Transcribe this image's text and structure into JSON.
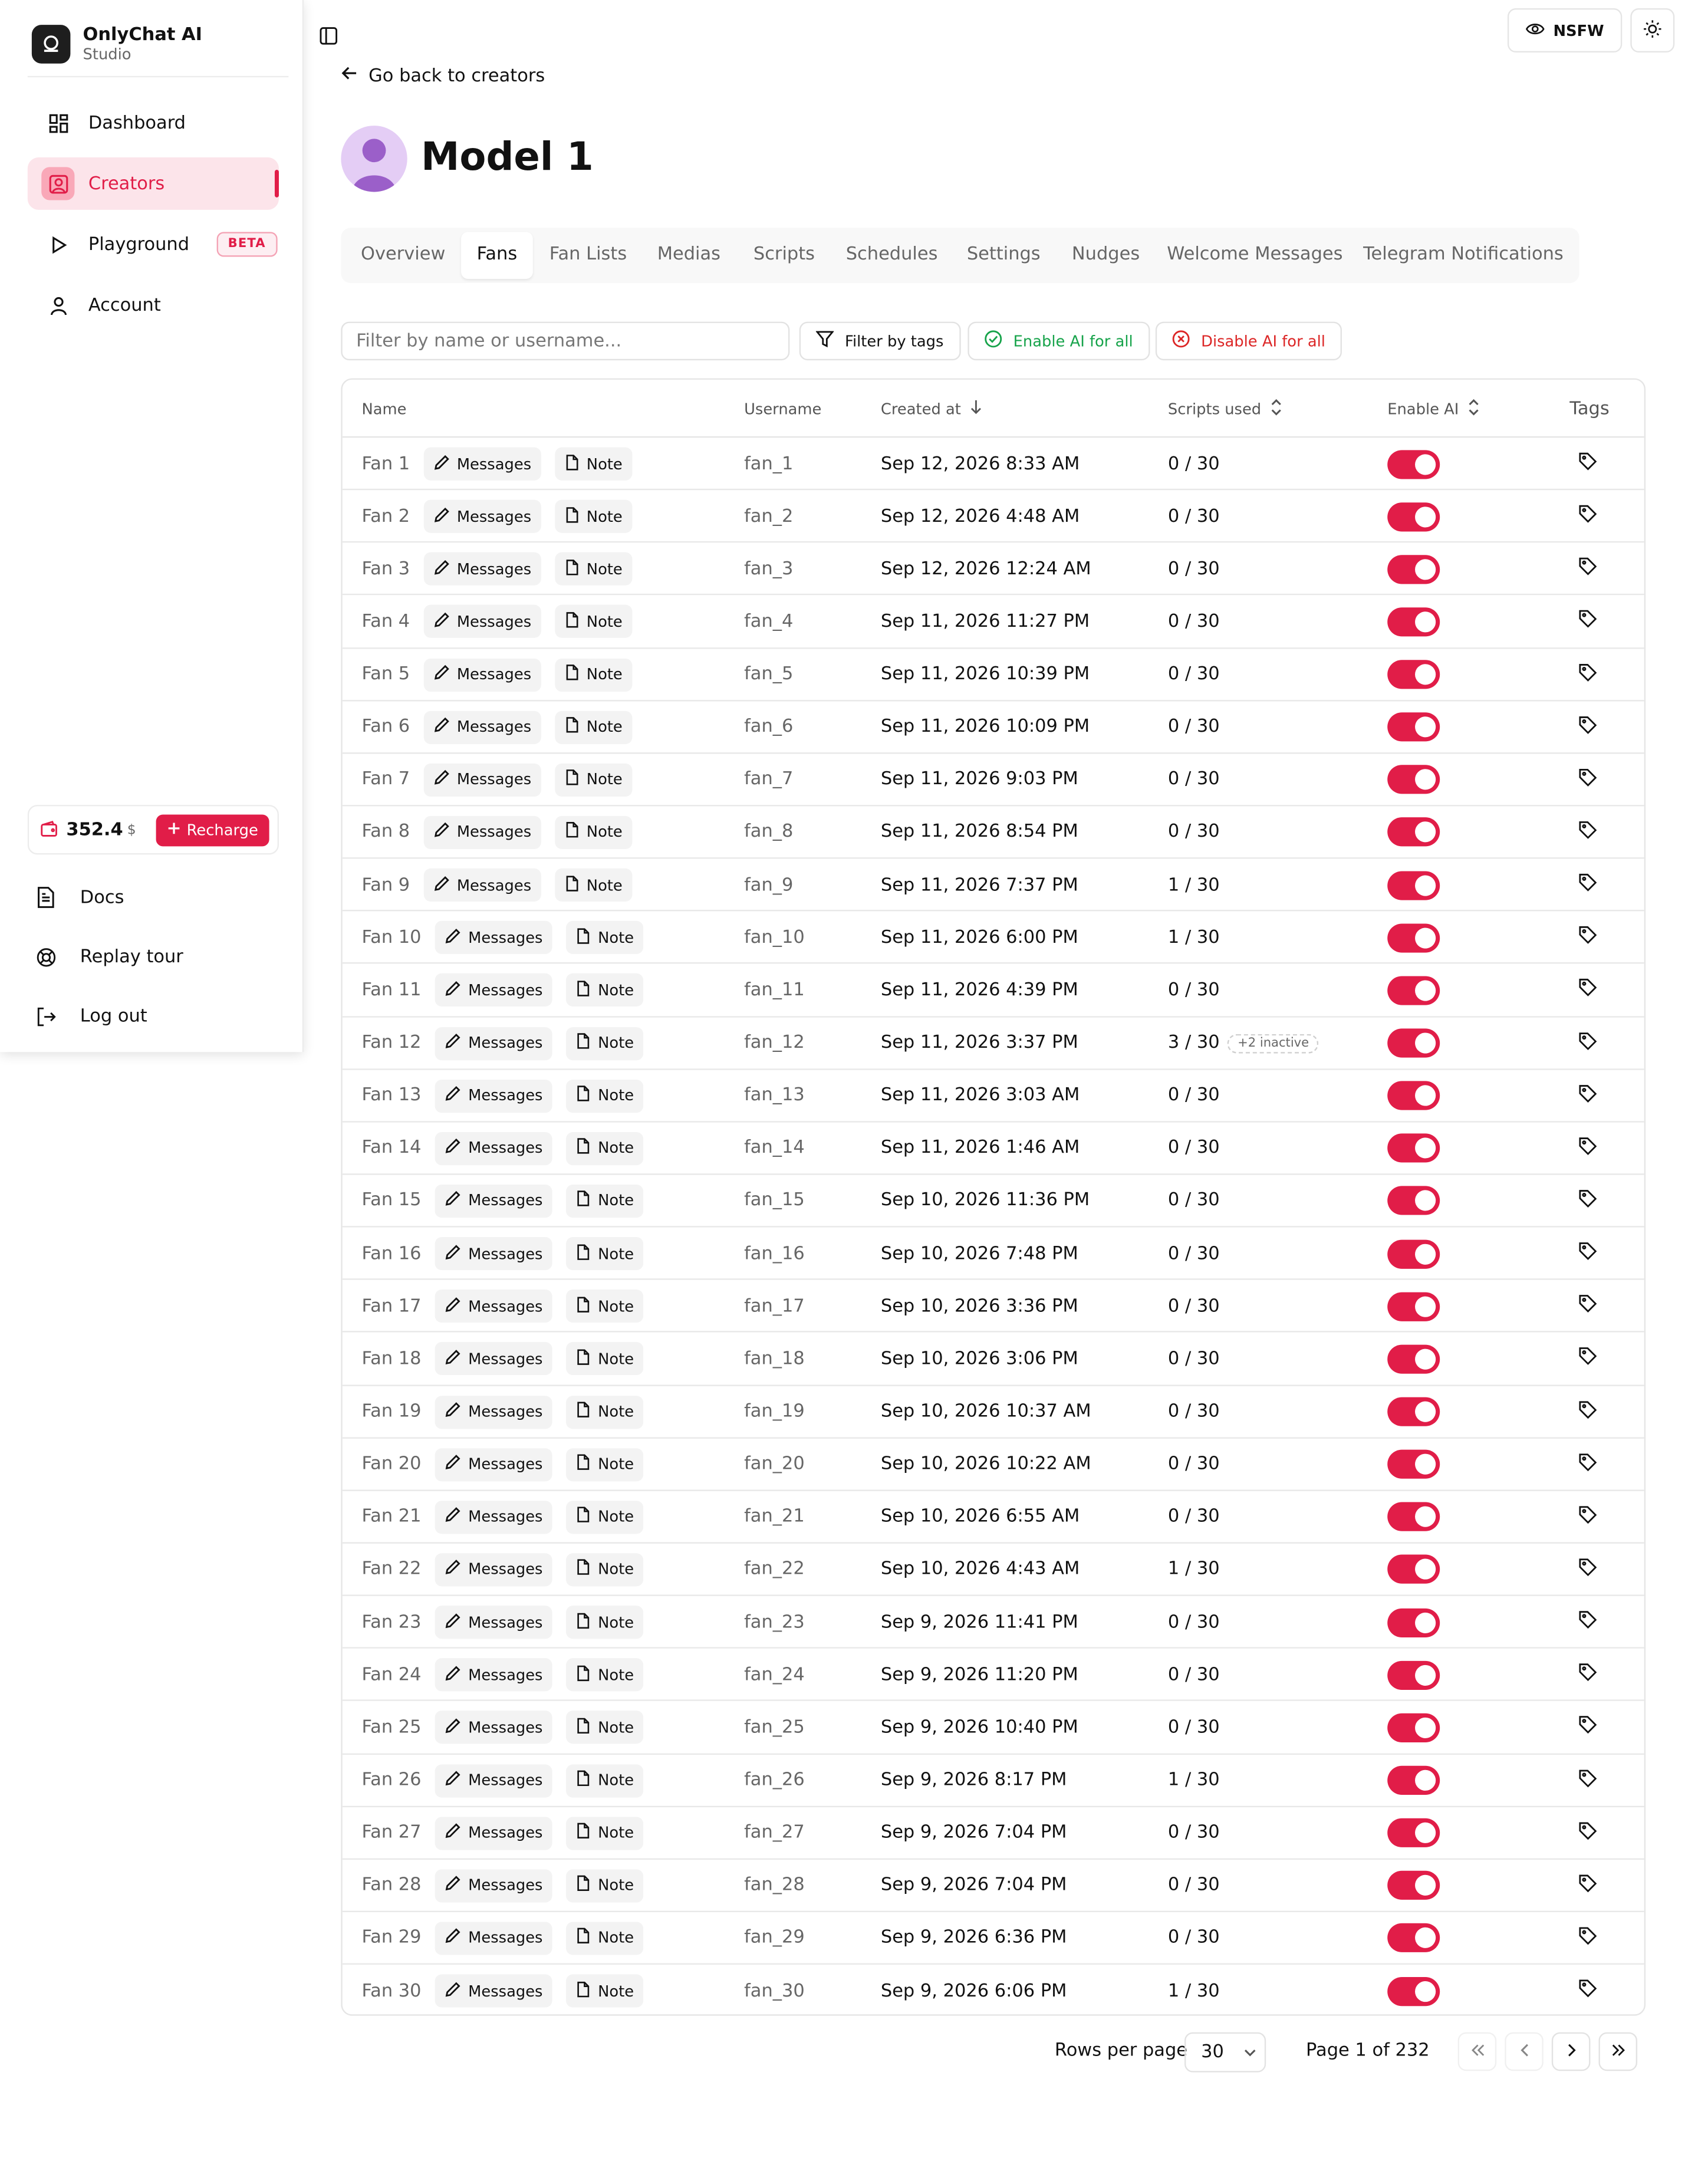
{
  "app": {
    "name": "OnlyChat AI",
    "subtitle": "Studio"
  },
  "sidebar": {
    "items": [
      {
        "label": "Dashboard",
        "icon": "dashboard-icon",
        "active": false
      },
      {
        "label": "Creators",
        "icon": "creator-icon",
        "active": true
      },
      {
        "label": "Playground",
        "icon": "play-icon",
        "active": false,
        "badge": "BETA"
      },
      {
        "label": "Account",
        "icon": "user-icon",
        "active": false
      }
    ],
    "wallet": {
      "amount": "352.4",
      "currency": "$",
      "recharge_label": "Recharge"
    },
    "bottom_items": [
      {
        "label": "Docs",
        "icon": "document-icon"
      },
      {
        "label": "Replay tour",
        "icon": "lifebuoy-icon"
      },
      {
        "label": "Log out",
        "icon": "logout-icon"
      }
    ]
  },
  "topbar": {
    "nsfw_label": "NSFW"
  },
  "header": {
    "back_label": "Go back to creators",
    "title": "Model 1"
  },
  "tabs": [
    {
      "label": "Overview",
      "active": false
    },
    {
      "label": "Fans",
      "active": true
    },
    {
      "label": "Fan Lists",
      "active": false
    },
    {
      "label": "Medias",
      "active": false
    },
    {
      "label": "Scripts",
      "active": false
    },
    {
      "label": "Schedules",
      "active": false
    },
    {
      "label": "Settings",
      "active": false
    },
    {
      "label": "Nudges",
      "active": false
    },
    {
      "label": "Welcome Messages",
      "active": false
    },
    {
      "label": "Telegram Notifications",
      "active": false
    }
  ],
  "toolbar": {
    "search_placeholder": "Filter by name or username...",
    "filter_tags_label": "Filter by tags",
    "enable_all_label": "Enable AI for all",
    "disable_all_label": "Disable AI for all"
  },
  "table": {
    "columns": {
      "name": "Name",
      "username": "Username",
      "created_at": "Created at",
      "scripts_used": "Scripts used",
      "enable_ai": "Enable AI",
      "tags": "Tags"
    },
    "messages_label": "Messages",
    "note_label": "Note",
    "rows": [
      {
        "name": "Fan 1",
        "username": "fan_1",
        "created": "Sep 12, 2026 8:33 AM",
        "scripts": "0 / 30",
        "extra": "",
        "ai": true
      },
      {
        "name": "Fan 2",
        "username": "fan_2",
        "created": "Sep 12, 2026 4:48 AM",
        "scripts": "0 / 30",
        "extra": "",
        "ai": true
      },
      {
        "name": "Fan 3",
        "username": "fan_3",
        "created": "Sep 12, 2026 12:24 AM",
        "scripts": "0 / 30",
        "extra": "",
        "ai": true
      },
      {
        "name": "Fan 4",
        "username": "fan_4",
        "created": "Sep 11, 2026 11:27 PM",
        "scripts": "0 / 30",
        "extra": "",
        "ai": true
      },
      {
        "name": "Fan 5",
        "username": "fan_5",
        "created": "Sep 11, 2026 10:39 PM",
        "scripts": "0 / 30",
        "extra": "",
        "ai": true
      },
      {
        "name": "Fan 6",
        "username": "fan_6",
        "created": "Sep 11, 2026 10:09 PM",
        "scripts": "0 / 30",
        "extra": "",
        "ai": true
      },
      {
        "name": "Fan 7",
        "username": "fan_7",
        "created": "Sep 11, 2026 9:03 PM",
        "scripts": "0 / 30",
        "extra": "",
        "ai": true
      },
      {
        "name": "Fan 8",
        "username": "fan_8",
        "created": "Sep 11, 2026 8:54 PM",
        "scripts": "0 / 30",
        "extra": "",
        "ai": true
      },
      {
        "name": "Fan 9",
        "username": "fan_9",
        "created": "Sep 11, 2026 7:37 PM",
        "scripts": "1 / 30",
        "extra": "",
        "ai": true
      },
      {
        "name": "Fan 10",
        "username": "fan_10",
        "created": "Sep 11, 2026 6:00 PM",
        "scripts": "1 / 30",
        "extra": "",
        "ai": true
      },
      {
        "name": "Fan 11",
        "username": "fan_11",
        "created": "Sep 11, 2026 4:39 PM",
        "scripts": "0 / 30",
        "extra": "",
        "ai": true
      },
      {
        "name": "Fan 12",
        "username": "fan_12",
        "created": "Sep 11, 2026 3:37 PM",
        "scripts": "3 / 30",
        "extra": "+2 inactive",
        "ai": true
      },
      {
        "name": "Fan 13",
        "username": "fan_13",
        "created": "Sep 11, 2026 3:03 AM",
        "scripts": "0 / 30",
        "extra": "",
        "ai": true
      },
      {
        "name": "Fan 14",
        "username": "fan_14",
        "created": "Sep 11, 2026 1:46 AM",
        "scripts": "0 / 30",
        "extra": "",
        "ai": true
      },
      {
        "name": "Fan 15",
        "username": "fan_15",
        "created": "Sep 10, 2026 11:36 PM",
        "scripts": "0 / 30",
        "extra": "",
        "ai": true
      },
      {
        "name": "Fan 16",
        "username": "fan_16",
        "created": "Sep 10, 2026 7:48 PM",
        "scripts": "0 / 30",
        "extra": "",
        "ai": true
      },
      {
        "name": "Fan 17",
        "username": "fan_17",
        "created": "Sep 10, 2026 3:36 PM",
        "scripts": "0 / 30",
        "extra": "",
        "ai": true
      },
      {
        "name": "Fan 18",
        "username": "fan_18",
        "created": "Sep 10, 2026 3:06 PM",
        "scripts": "0 / 30",
        "extra": "",
        "ai": true
      },
      {
        "name": "Fan 19",
        "username": "fan_19",
        "created": "Sep 10, 2026 10:37 AM",
        "scripts": "0 / 30",
        "extra": "",
        "ai": true
      },
      {
        "name": "Fan 20",
        "username": "fan_20",
        "created": "Sep 10, 2026 10:22 AM",
        "scripts": "0 / 30",
        "extra": "",
        "ai": true
      },
      {
        "name": "Fan 21",
        "username": "fan_21",
        "created": "Sep 10, 2026 6:55 AM",
        "scripts": "0 / 30",
        "extra": "",
        "ai": true
      },
      {
        "name": "Fan 22",
        "username": "fan_22",
        "created": "Sep 10, 2026 4:43 AM",
        "scripts": "1 / 30",
        "extra": "",
        "ai": true
      },
      {
        "name": "Fan 23",
        "username": "fan_23",
        "created": "Sep 9, 2026 11:41 PM",
        "scripts": "0 / 30",
        "extra": "",
        "ai": true
      },
      {
        "name": "Fan 24",
        "username": "fan_24",
        "created": "Sep 9, 2026 11:20 PM",
        "scripts": "0 / 30",
        "extra": "",
        "ai": true
      },
      {
        "name": "Fan 25",
        "username": "fan_25",
        "created": "Sep 9, 2026 10:40 PM",
        "scripts": "0 / 30",
        "extra": "",
        "ai": true
      },
      {
        "name": "Fan 26",
        "username": "fan_26",
        "created": "Sep 9, 2026 8:17 PM",
        "scripts": "1 / 30",
        "extra": "",
        "ai": true
      },
      {
        "name": "Fan 27",
        "username": "fan_27",
        "created": "Sep 9, 2026 7:04 PM",
        "scripts": "0 / 30",
        "extra": "",
        "ai": true
      },
      {
        "name": "Fan 28",
        "username": "fan_28",
        "created": "Sep 9, 2026 7:04 PM",
        "scripts": "0 / 30",
        "extra": "",
        "ai": true
      },
      {
        "name": "Fan 29",
        "username": "fan_29",
        "created": "Sep 9, 2026 6:36 PM",
        "scripts": "0 / 30",
        "extra": "",
        "ai": true
      },
      {
        "name": "Fan 30",
        "username": "fan_30",
        "created": "Sep 9, 2026 6:06 PM",
        "scripts": "1 / 30",
        "extra": "",
        "ai": true
      }
    ]
  },
  "pagination": {
    "rows_per_page_label": "Rows per page",
    "rows_per_page_value": "30",
    "page_info": "Page 1 of 232"
  },
  "colors": {
    "accent": "#e11d48",
    "success": "#16a34a",
    "danger": "#dc2626"
  }
}
